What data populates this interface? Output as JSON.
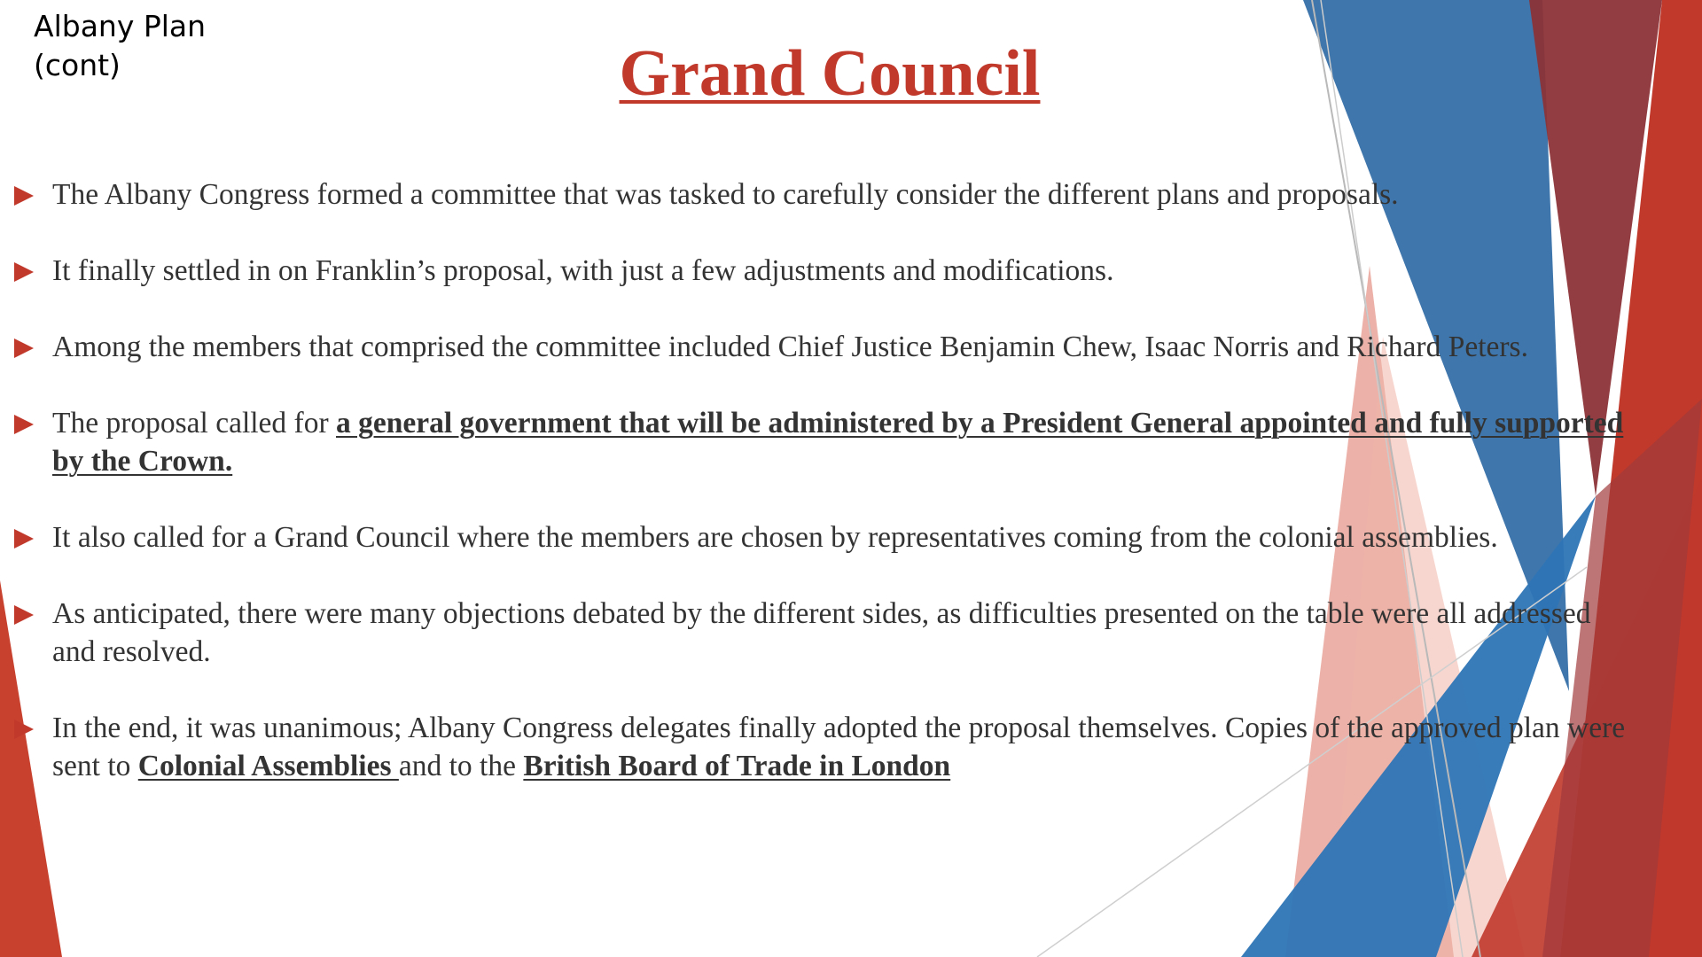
{
  "slide": {
    "corner_label": "Albany Plan\n(cont)",
    "title": "Grand Council",
    "bullets": [
      {
        "text": "The Albany Congress formed a committee that was tasked to carefully consider the different plans and proposals."
      },
      {
        "text": "It finally settled in on Franklin’s proposal, with just a few adjustments and modifications."
      },
      {
        "text": "Among the members that comprised the committee included Chief Justice Benjamin Chew, Isaac Norris and Richard Peters."
      },
      {
        "prefix": "The proposal called for ",
        "emphasis": "a general government that will be administered by a President General appointed and fully supported by the Crown."
      },
      {
        "text": "It also called for a Grand Council where the members are chosen by representatives coming from the colonial assemblies."
      },
      {
        "text": "As anticipated, there were many objections debated by the different sides, as difficulties presented on the table were all addressed and resolved."
      },
      {
        "prefix": "In the end, it was unanimous; Albany Congress delegates finally adopted the proposal themselves. Copies of the approved plan were sent to ",
        "emphasis1": "Colonial Assemblies ",
        "middle": "and to the ",
        "emphasis2": "British Board of Trade in London"
      }
    ]
  },
  "colors": {
    "accent_red": "#c0392b",
    "accent_blue": "#2e75b6",
    "body_text": "#333333"
  },
  "icons": [
    "triangle-bullet-icon"
  ]
}
